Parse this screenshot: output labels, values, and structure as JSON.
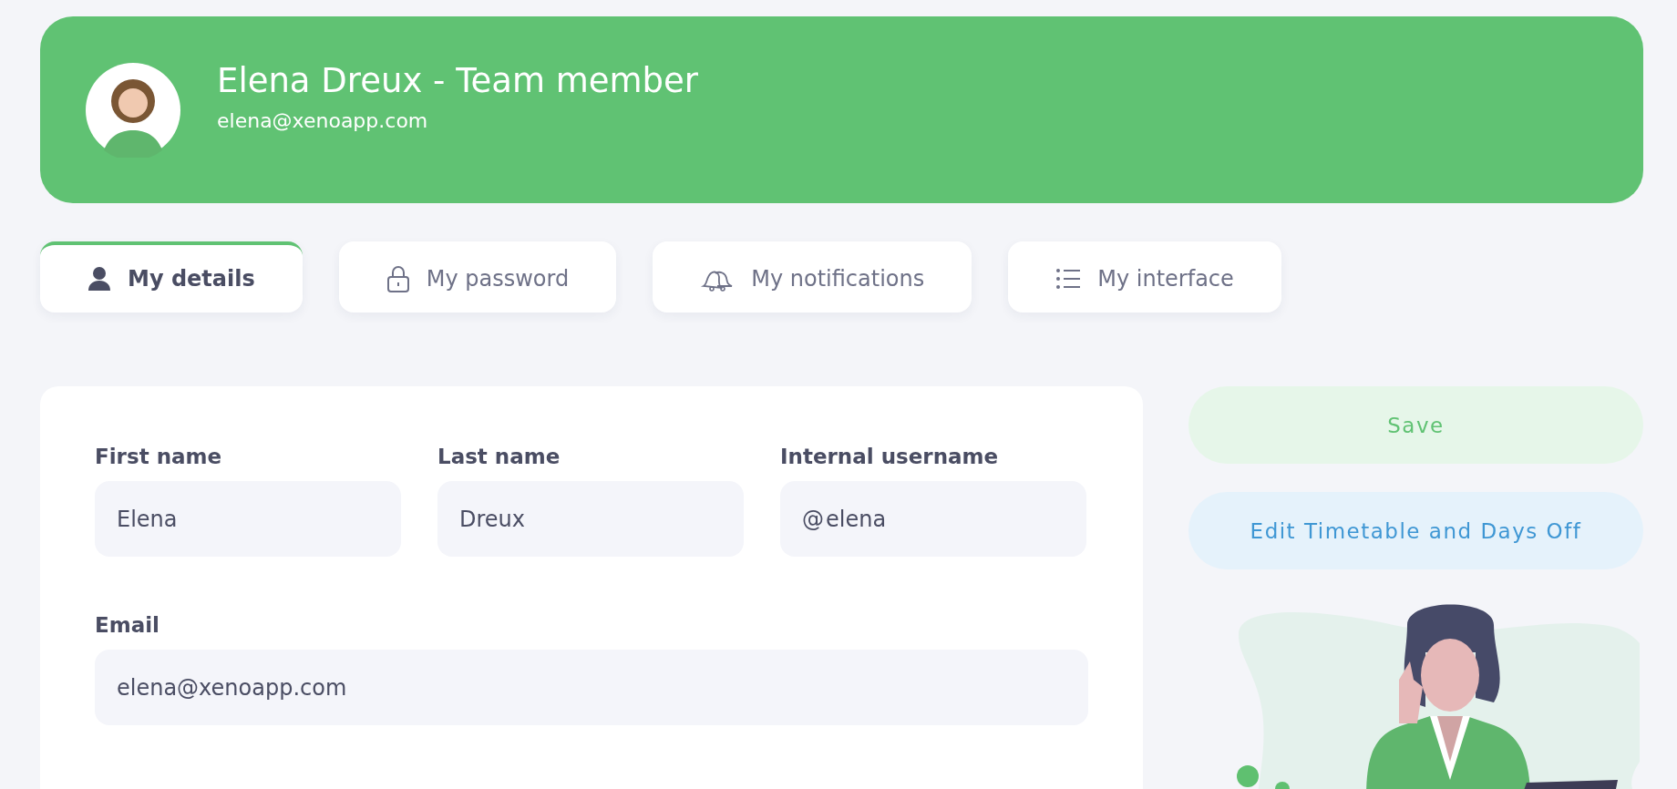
{
  "header": {
    "name": "Elena Dreux - Team member",
    "email": "elena@xenoapp.com"
  },
  "tabs": [
    {
      "label": "My details",
      "kind": "user",
      "selected": true
    },
    {
      "label": "My password",
      "kind": "lock",
      "selected": false
    },
    {
      "label": "My notifications",
      "kind": "bells",
      "selected": false
    },
    {
      "label": "My interface",
      "kind": "list",
      "selected": false
    }
  ],
  "form": {
    "rows": [
      [
        {
          "label": "First name",
          "value": "Elena"
        },
        {
          "label": "Last name",
          "value": "Dreux"
        },
        {
          "label": "Internal username",
          "prefix": "@",
          "value": "elena"
        }
      ],
      [
        {
          "label": "Email",
          "value": "elena@xenoapp.com"
        }
      ]
    ]
  },
  "actions": [
    {
      "label": "Save",
      "kind": "primary"
    },
    {
      "label": "Edit Timetable and Days Off",
      "kind": "secondary"
    }
  ]
}
